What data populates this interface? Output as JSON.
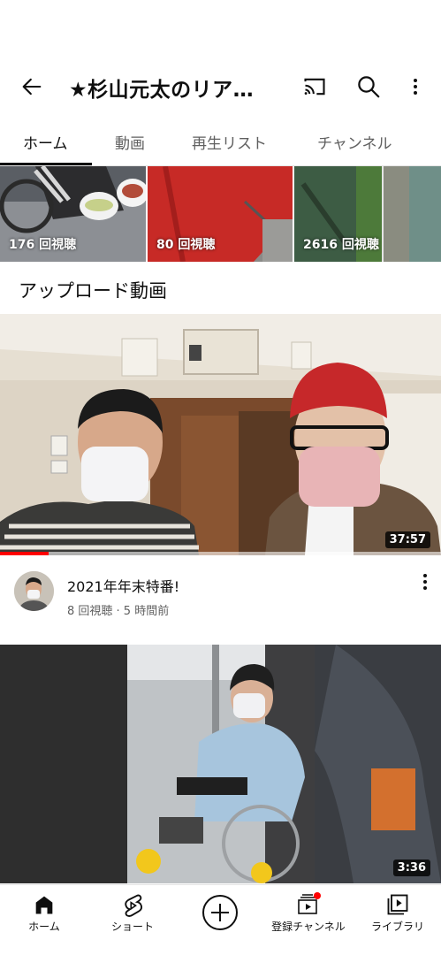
{
  "app_bar": {
    "title": "★杉山元太のリア…",
    "back_icon": "arrow-left-icon",
    "cast_icon": "cast-icon",
    "search_icon": "search-icon",
    "more_icon": "more-vertical-icon"
  },
  "tabs": [
    {
      "label": "ホーム",
      "active": true
    },
    {
      "label": "動画",
      "active": false
    },
    {
      "label": "再生リスト",
      "active": false
    },
    {
      "label": "チャンネル",
      "active": false
    }
  ],
  "shelf": [
    {
      "views": "176 回視聴"
    },
    {
      "views": "80 回視聴"
    },
    {
      "views": "2616 回視聴"
    }
  ],
  "section_title": "アップロード動画",
  "videos": [
    {
      "duration": "37:57",
      "watched_fraction": 0.11,
      "title": "2021年年末特番!",
      "subtitle": "8 回視聴 · 5 時間前"
    },
    {
      "duration": "3:36"
    }
  ],
  "bottom_nav": [
    {
      "label": "ホーム",
      "icon": "home-icon"
    },
    {
      "label": "ショート",
      "icon": "shorts-icon"
    },
    {
      "label": "",
      "icon": "create-icon"
    },
    {
      "label": "登録チャンネル",
      "icon": "subscriptions-icon"
    },
    {
      "label": "ライブラリ",
      "icon": "library-icon"
    }
  ],
  "colors": {
    "accent": "#ff0000",
    "text": "#0f0f0f",
    "secondary_text": "#606060"
  }
}
